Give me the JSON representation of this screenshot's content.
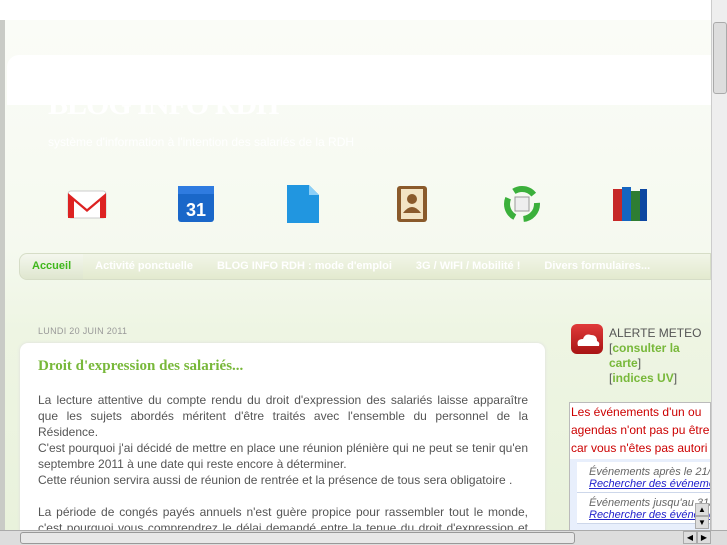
{
  "blog": {
    "title": "BLOG INFO RDH",
    "description": "système d'information à l'intention des salariés de la RDH"
  },
  "shortcuts": [
    "gmail-icon",
    "calendar-icon",
    "docs-icon",
    "contacts-icon",
    "recycle-icon",
    "books-icon"
  ],
  "calendar_day": "31",
  "tabs": [
    {
      "label": "Accueil"
    },
    {
      "label": "Activité ponctuelle"
    },
    {
      "label": "BLOG INFO RDH : mode d'emploi"
    },
    {
      "label": "3G / WIFI / Mobilité !"
    },
    {
      "label": "Divers formulaires..."
    }
  ],
  "post": {
    "date": "LUNDI 20 JUIN 2011",
    "title": "Droit d'expression des salariés...",
    "p1": [
      "La lecture attentive du compte rendu du droit d'expression des salariés laisse apparaître que les sujets abordés méritent d'être traités avec l'ensemble du personnel de la Résidence.",
      "C'est pourquoi j'ai décidé de mettre en place une réunion plénière qui ne peut se tenir qu'en septembre 2011 à une date qui reste encore à déterminer.",
      "Cette réunion servira aussi de réunion de rentrée et la présence de tous sera obligatoire ."
    ],
    "p2": "La période de congés payés annuels n'est guère propice pour rassembler tout le monde, c'est pourquoi vous comprendrez le délai demandé entre la tenue du droit d'expression et les réponses."
  },
  "sidebar": {
    "meteo_title": "ALERTE METEO",
    "link_map": "consulter la carte",
    "link_uv": "indices UV",
    "calendar_error": [
      "Les événements d'un ou",
      "agendas n'ont pas pu être",
      "car vous n'êtes pas autori"
    ],
    "events": [
      {
        "label": "Événements après le 21/",
        "link": "Rechercher des événements"
      },
      {
        "label": "Événements jusqu'au 31/",
        "link": "Rechercher des événements"
      }
    ]
  }
}
